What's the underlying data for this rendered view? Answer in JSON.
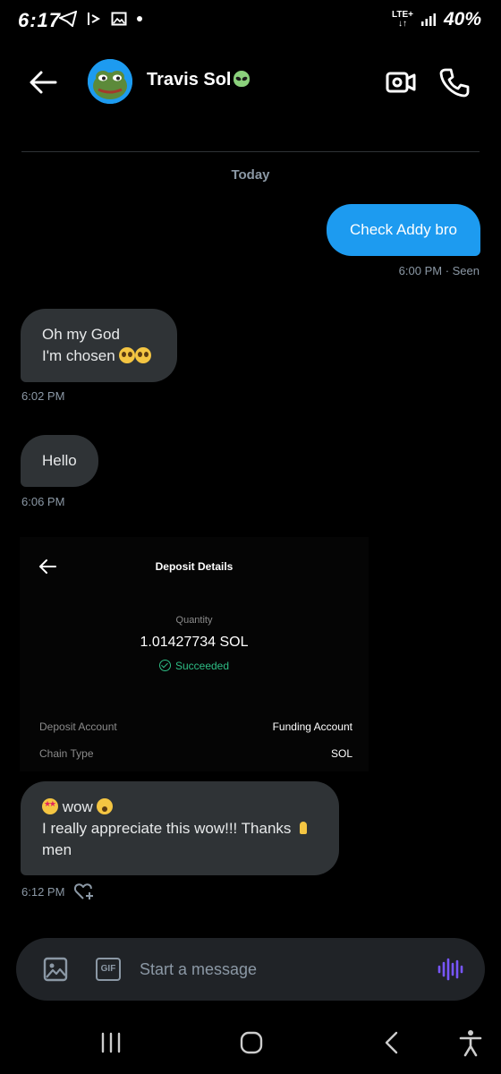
{
  "status_bar": {
    "time": "6:17",
    "network": "LTE+",
    "battery": "40%"
  },
  "header": {
    "contact_name": "Travis Sol",
    "back_icon": "arrow-left-icon",
    "video_icon": "video-camera-icon",
    "call_icon": "phone-icon"
  },
  "day_label": "Today",
  "messages": [
    {
      "direction": "sent",
      "text": "Check Addy bro",
      "meta": "6:00 PM · Seen"
    },
    {
      "direction": "received",
      "lines": [
        "Oh my God",
        "I'm chosen"
      ],
      "meta": "6:02 PM"
    },
    {
      "direction": "received",
      "text": "Hello",
      "meta": "6:06 PM"
    },
    {
      "direction": "received",
      "lines": [
        "wow",
        "I really appreciate this wow!!! Thanks",
        "men"
      ],
      "meta": "6:12 PM"
    }
  ],
  "deposit": {
    "title": "Deposit Details",
    "quantity_label": "Quantity",
    "amount": "1.01427734 SOL",
    "status": "Succeeded",
    "rows": [
      {
        "label": "Deposit Account",
        "value": "Funding Account"
      },
      {
        "label": "Chain Type",
        "value": "SOL"
      }
    ]
  },
  "composer": {
    "placeholder": "Start a message",
    "gif_label": "GIF"
  },
  "colors": {
    "accent": "#1d9bf0",
    "bubble_received": "#2f3336",
    "success": "#2ebd85",
    "voice": "#7856ff"
  }
}
